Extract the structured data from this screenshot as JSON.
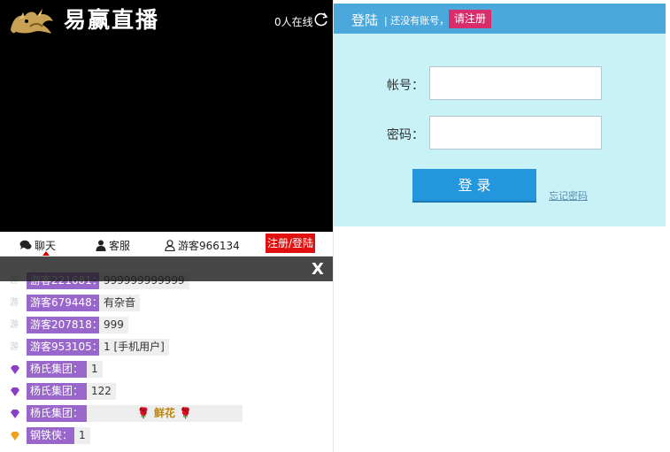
{
  "header": {
    "brand": "易赢直播",
    "online_count": "0人在线"
  },
  "tabs": {
    "chat": "聊天",
    "service": "客服",
    "guest": "游客966134",
    "register_login": "注册/登陆"
  },
  "chat": {
    "messages": [
      {
        "badge": "guest",
        "name": "游客221681：",
        "text": "999999999999"
      },
      {
        "badge": "guest",
        "name": "游客679448：",
        "text": "有杂音"
      },
      {
        "badge": "guest",
        "name": "游客207818：",
        "text": "999"
      },
      {
        "badge": "guest",
        "name": "游客953105：",
        "text": "1 [手机用户]"
      },
      {
        "badge": "purple-gem",
        "name": "杨氏集团：",
        "text": "1"
      },
      {
        "badge": "purple-gem",
        "name": "杨氏集团：",
        "text": "122"
      },
      {
        "badge": "purple-gem",
        "name": "杨氏集团：",
        "text": "🌹 鲜花 🌹"
      },
      {
        "badge": "orange-gem",
        "name": "钢铁侠：",
        "text": "1"
      }
    ],
    "close_label": "X"
  },
  "login": {
    "title": "登陆",
    "no_account": "| 还没有账号，",
    "register_button": "请注册",
    "account_label": "帐号：",
    "password_label": "密码：",
    "account_value": "",
    "password_value": "",
    "submit": "登 录",
    "forgot": "忘记密码"
  },
  "colors": {
    "header_bg": "#4aa8dc",
    "form_bg": "#c8f1f8",
    "login_button": "#2496dd",
    "register_button": "#d92d6b",
    "name_tag": "#9966cc",
    "register_login_tab": "#e01010"
  }
}
